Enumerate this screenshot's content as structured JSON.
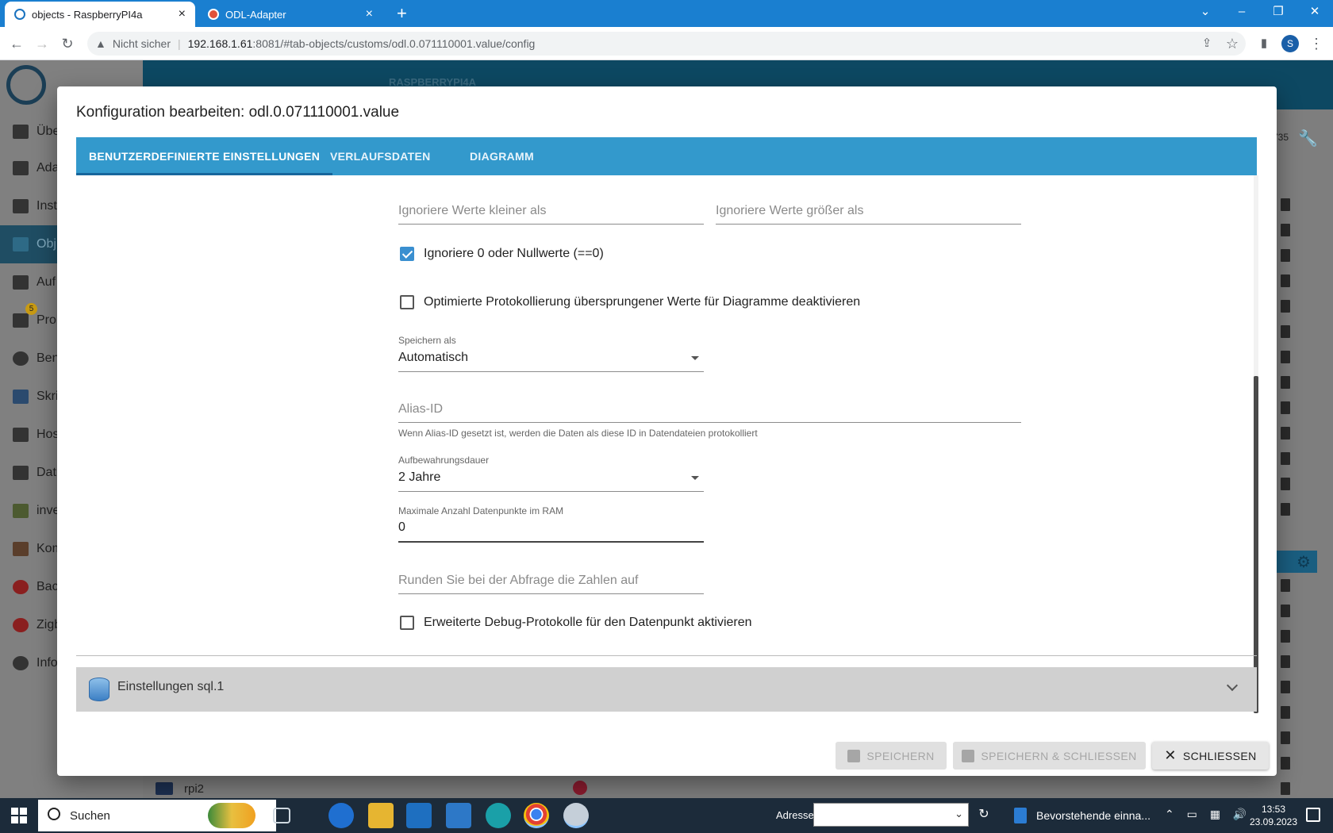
{
  "browser": {
    "tabs": [
      {
        "title": "objects - RaspberryPI4a",
        "active": true
      },
      {
        "title": "ODL-Adapter",
        "active": false
      }
    ],
    "new_tab": "+",
    "security_label": "Nicht sicher",
    "url_host": "192.168.1.61",
    "url_rest": ":8081/#tab-objects/customs/odl.0.071110001.value/config",
    "profile_initial": "S"
  },
  "background": {
    "header_title": "RASPBERRYPI4A",
    "sidebar": [
      "Übe",
      "Ada",
      "Inst",
      "Obj",
      "Auf",
      "Pro",
      "Ben",
      "Skri",
      "Hos",
      "Dat",
      "inve",
      "Kom",
      "Bac",
      "Zigb",
      "Info"
    ],
    "notification_count": "5",
    "row_label": "rpi2",
    "partial_number": "735"
  },
  "dialog": {
    "title": "Konfiguration bearbeiten: odl.0.071110001.value",
    "tabs": [
      "BENUTZERDEFINIERTE EINSTELLUNGEN",
      "VERLAUFSDATEN",
      "DIAGRAMM"
    ],
    "fields": {
      "ignore_below": {
        "placeholder": "Ignoriere Werte kleiner als"
      },
      "ignore_above": {
        "placeholder": "Ignoriere Werte größer als"
      },
      "ignore_zero": {
        "label": "Ignoriere 0 oder Nullwerte (==0)",
        "checked": true
      },
      "disable_optimized": {
        "label": "Optimierte Protokollierung übersprungener Werte für Diagramme deaktivieren",
        "checked": false
      },
      "store_as": {
        "label": "Speichern als",
        "value": "Automatisch"
      },
      "alias_id": {
        "placeholder": "Alias-ID",
        "helper": "Wenn Alias-ID gesetzt ist, werden die Daten als diese ID in Datendateien protokolliert"
      },
      "retention": {
        "label": "Aufbewahrungsdauer",
        "value": "2 Jahre"
      },
      "max_ram": {
        "label": "Maximale Anzahl Datenpunkte im RAM",
        "value": "0"
      },
      "round": {
        "placeholder": "Runden Sie bei der Abfrage die Zahlen auf"
      },
      "debug": {
        "label": "Erweiterte Debug-Protokolle für den Datenpunkt aktivieren",
        "checked": false
      }
    },
    "accordion": {
      "label": "Einstellungen sql.1"
    },
    "buttons": {
      "save": "SPEICHERN",
      "save_close": "SPEICHERN & SCHLIESSEN",
      "close": "SCHLIESSEN"
    }
  },
  "taskbar": {
    "search_label": "Suchen",
    "address_label": "Adresse",
    "upcoming": "Bevorstehende einna...",
    "time": "13:53",
    "date": "23.09.2023"
  }
}
